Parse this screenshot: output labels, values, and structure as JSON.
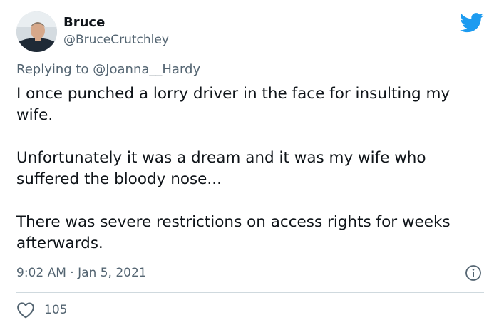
{
  "tweet": {
    "author": {
      "name": "Bruce",
      "handle": "@BruceCrutchley",
      "avatar_icon": "user-avatar"
    },
    "reply_to": {
      "prefix": "Replying to ",
      "mention": "@Joanna__Hardy"
    },
    "paragraphs": [
      "I once punched a lorry driver in the face for insulting my wife.",
      "Unfortunately it was a dream and it was my wife who suffered the bloody nose...",
      "There was severe restrictions on access rights for weeks afterwards."
    ],
    "timestamp": "9:02 AM · Jan 5, 2021",
    "likes": "105",
    "icons": {
      "brand": "twitter-bird-icon",
      "info": "info-icon",
      "like": "heart-icon"
    }
  },
  "colors": {
    "brand": "#1d9bf0",
    "text": "#0f1419",
    "secondary": "#536471",
    "divider": "#cfd9de"
  }
}
